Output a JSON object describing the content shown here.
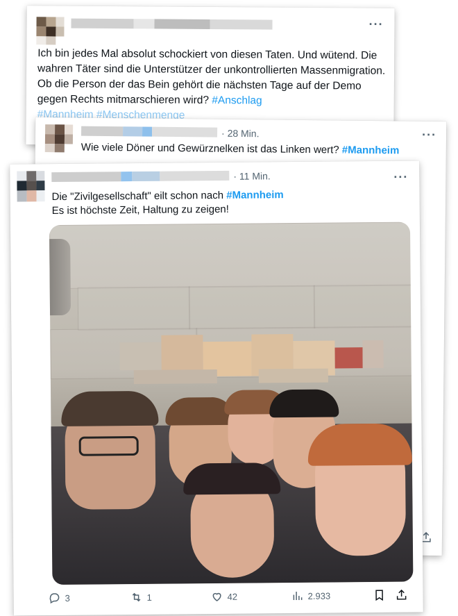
{
  "tweets": [
    {
      "text_parts": [
        "Ich bin jedes Mal absolut schockiert von diesen Taten. Und wütend. Die wahren Täter sind die Unterstützer der unkontrollierten Massenmigration. Ob die Person der das Bein gehört die nächsten Tage auf der Demo gegen Rechts mitmarschieren wird? "
      ],
      "hashtags": [
        "#Anschlag",
        "#Mannheim",
        "#Menschenmenge"
      ],
      "more": "···"
    },
    {
      "time": "· 28 Min.",
      "text": "Wie viele Döner und Gewürznelken ist das Linken wert? ",
      "hashtag": "#Mannheim",
      "more": "···"
    },
    {
      "time": "· 11 Min.",
      "line1": "Die \"Zivilgesellschaft\" eilt schon nach ",
      "hashtag": "#Mannheim",
      "line2": "Es ist höchste Zeit, Haltung zu zeigen!",
      "more": "···",
      "actions": {
        "replies": "3",
        "retweets": "1",
        "likes": "42",
        "views": "2.933"
      }
    }
  ],
  "icons": [
    "reply-icon",
    "retweet-icon",
    "like-icon",
    "views-icon",
    "bookmark-icon",
    "share-icon"
  ],
  "colors": {
    "link": "#1d9bf0",
    "muted": "#536471",
    "text": "#0f1419"
  }
}
